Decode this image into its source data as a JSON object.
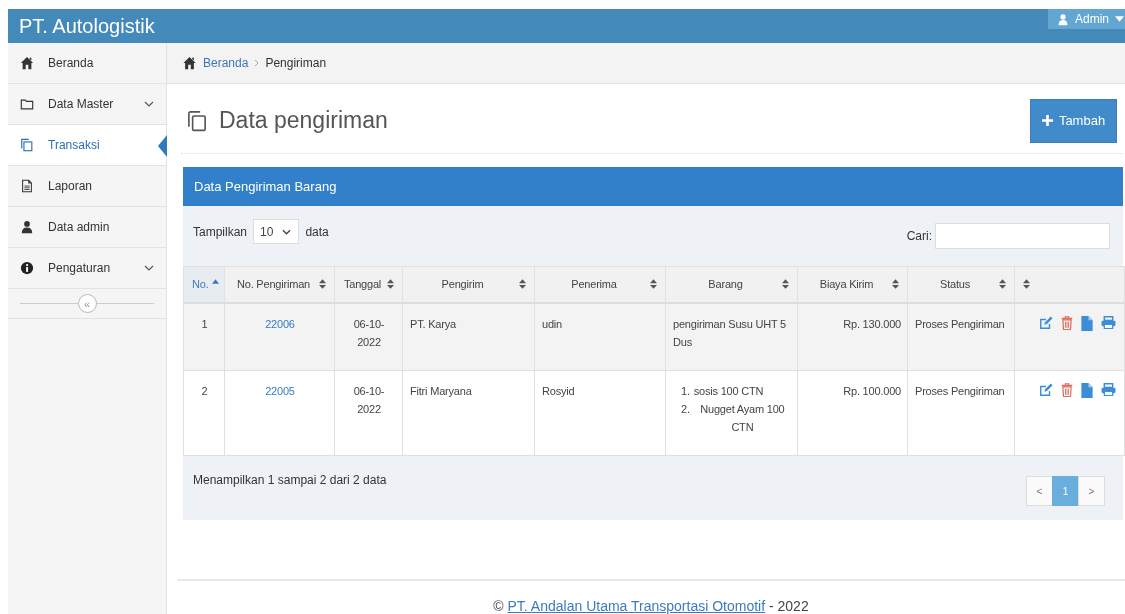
{
  "header": {
    "brand": "PT. Autologistik",
    "user": {
      "name": "Admin"
    }
  },
  "sidebar": {
    "items": [
      {
        "label": "Beranda",
        "selected": false,
        "has_submenu": false
      },
      {
        "label": "Data Master",
        "selected": false,
        "has_submenu": true
      },
      {
        "label": "Transaksi",
        "selected": true,
        "has_submenu": false
      },
      {
        "label": "Laporan",
        "selected": false,
        "has_submenu": false
      },
      {
        "label": "Data admin",
        "selected": false,
        "has_submenu": false
      },
      {
        "label": "Pengaturan",
        "selected": false,
        "has_submenu": true
      }
    ],
    "collapse_label": "«"
  },
  "breadcrumb": [
    {
      "label": "Beranda",
      "link": true
    },
    {
      "label": "Pengiriman",
      "link": false
    }
  ],
  "page_title": "Data pengiriman",
  "add_button": "Tambah",
  "panel": {
    "title": "Data Pengiriman Barang",
    "length": {
      "before": "Tampilkan",
      "value": "10",
      "after": "data"
    },
    "search": {
      "label": "Cari:"
    },
    "columns": [
      {
        "label": "No.",
        "sorted": true
      },
      {
        "label": "No. Pengiriman",
        "sorted": false
      },
      {
        "label": "Tanggal",
        "sorted": false
      },
      {
        "label": "Pengirim",
        "sorted": false
      },
      {
        "label": "Penerima",
        "sorted": false
      },
      {
        "label": "Barang",
        "sorted": false
      },
      {
        "label": "Biaya Kirim",
        "sorted": false
      },
      {
        "label": "Status",
        "sorted": false
      },
      {
        "sorted": false
      }
    ],
    "rows": [
      {
        "no": "1",
        "shipment_no": "22006",
        "date": "06-10-2022",
        "sender": "PT. Karya",
        "receiver": "udin",
        "goods": {
          "kind": "text",
          "text": "pengiriman Susu UHT 5 Dus"
        },
        "cost": "Rp. 130.000",
        "status": "Proses Pengiriman"
      },
      {
        "no": "2",
        "shipment_no": "22005",
        "date": "06-10-2022",
        "sender": "Fitri Maryana",
        "receiver": "Rosyid",
        "goods": {
          "kind": "list",
          "items": [
            {
              "number": "1.",
              "text": "sosis 100 CTN"
            },
            {
              "number": "2.",
              "text": "Nugget Ayam 100 CTN"
            }
          ]
        },
        "cost": "Rp. 100.000",
        "status": "Proses Pengiriman"
      }
    ],
    "info": "Menampilkan 1 sampai 2 dari 2 data",
    "pagination": {
      "prev": "<",
      "pages": [
        {
          "label": "1",
          "selected": true
        }
      ],
      "next": ">"
    }
  },
  "footer": {
    "prefix": "©",
    "link": "PT. Andalan Utama Transportasi Otomotif",
    "suffix": "- 2022"
  }
}
